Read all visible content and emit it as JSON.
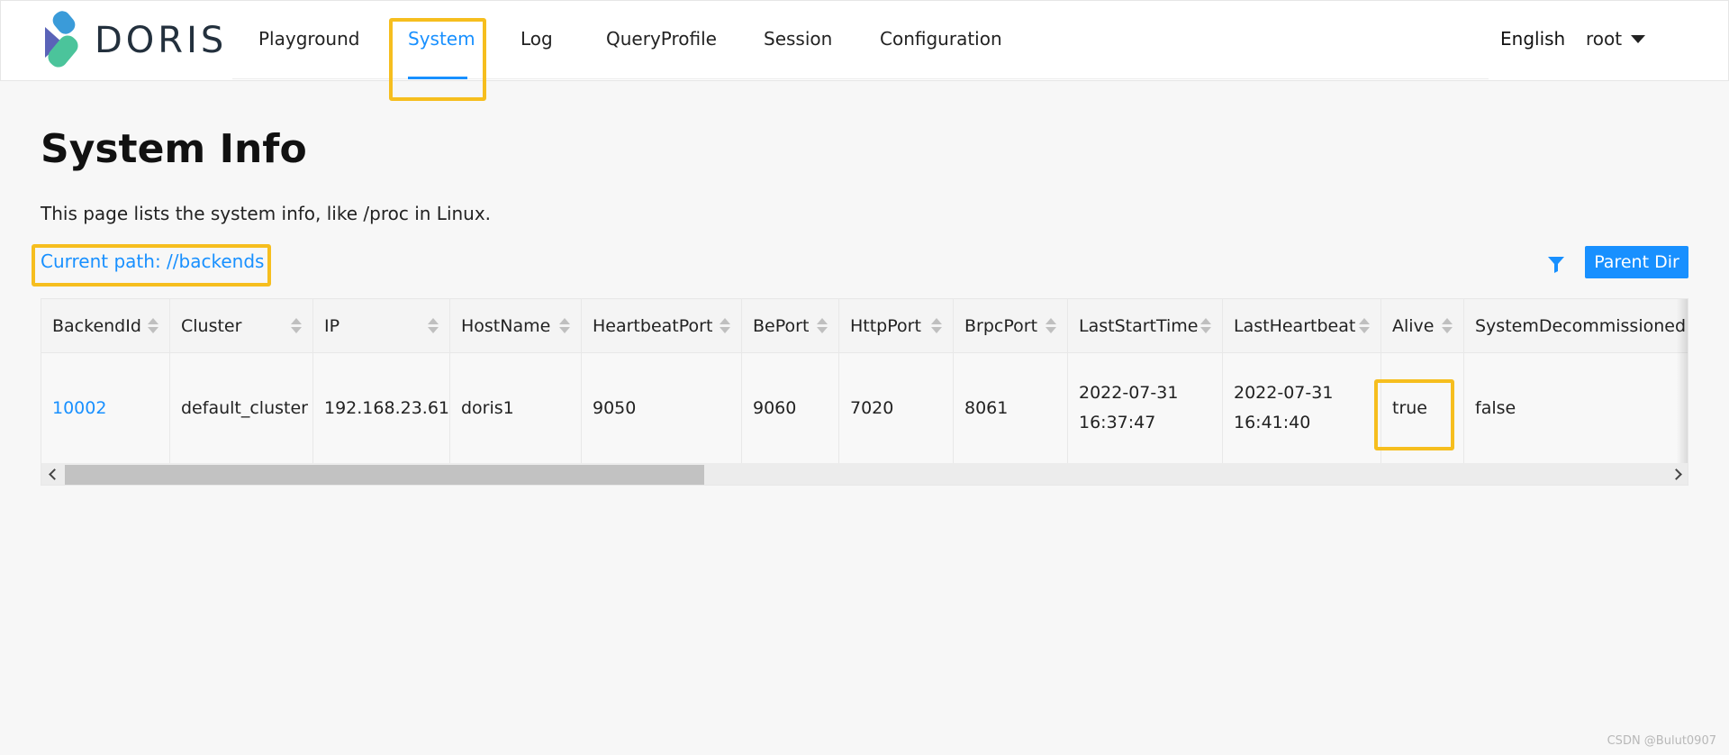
{
  "brand": {
    "name": "DORIS",
    "logo_colors": [
      "#3a9bd9",
      "#4bc49b",
      "#5a63b8"
    ]
  },
  "nav": {
    "items": [
      {
        "label": "Playground"
      },
      {
        "label": "System"
      },
      {
        "label": "Log"
      },
      {
        "label": "QueryProfile"
      },
      {
        "label": "Session"
      },
      {
        "label": "Configuration"
      }
    ],
    "active": "System",
    "language": "English",
    "user": "root"
  },
  "page": {
    "title": "System Info",
    "description": "This page lists the system info, like /proc in Linux.",
    "current_path": "Current path: //backends",
    "parent_dir_label": "Parent Dir"
  },
  "table": {
    "columns": [
      "BackendId",
      "Cluster",
      "IP",
      "HostName",
      "HeartbeatPort",
      "BePort",
      "HttpPort",
      "BrpcPort",
      "LastStartTime",
      "LastHeartbeat",
      "Alive",
      "SystemDecommissioned"
    ],
    "rows": [
      [
        "10002",
        "default_cluster",
        "192.168.23.61",
        "doris1",
        "9050",
        "9060",
        "7020",
        "8061",
        "2022-07-31\n16:37:47",
        "2022-07-31\n16:41:40",
        "true",
        "false"
      ]
    ],
    "horizontal_scroll_fraction": 0.39
  },
  "colors": {
    "accent": "#1890ff",
    "highlight": "#f6be1e"
  },
  "watermark": "CSDN @Bulut0907"
}
